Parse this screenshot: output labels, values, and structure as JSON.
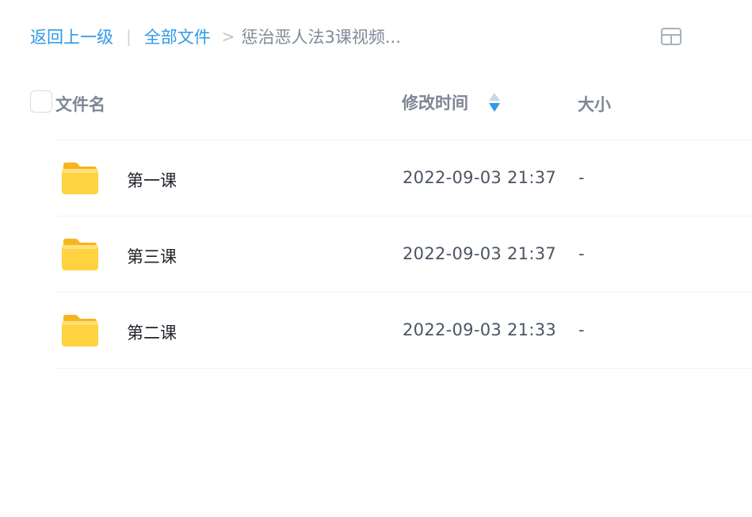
{
  "breadcrumb": {
    "back_label": "返回上一级",
    "separator": "|",
    "root_label": "全部文件",
    "arrow": ">",
    "current_label": "惩治恶人法3课视频..."
  },
  "view_toggle_icon": "grid-view-icon",
  "table": {
    "headers": {
      "name": "文件名",
      "modified": "修改时间",
      "size": "大小"
    },
    "sort_icon": "sort-icon",
    "rows": [
      {
        "name": "第一课",
        "modified": "2022-09-03 21:37",
        "size": "-",
        "icon": "folder-icon"
      },
      {
        "name": "第三课",
        "modified": "2022-09-03 21:37",
        "size": "-",
        "icon": "folder-icon"
      },
      {
        "name": "第二课",
        "modified": "2022-09-03 21:33",
        "size": "-",
        "icon": "folder-icon"
      }
    ]
  },
  "colors": {
    "link": "#2e9ae8",
    "folder": "#ffc72c",
    "sort_active": "#2e9ae8"
  }
}
